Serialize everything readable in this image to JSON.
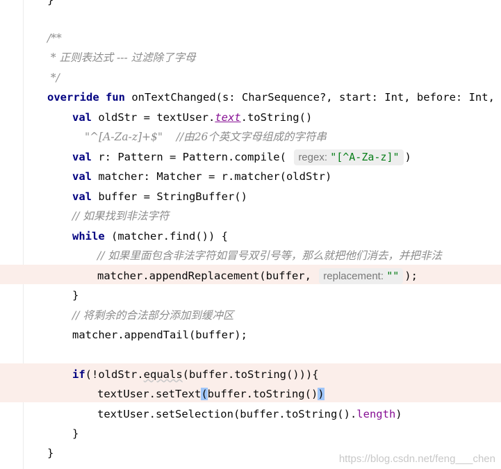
{
  "editor": {
    "top_brace": "}",
    "doc_start": "/**",
    "doc_title": " * 正则表达式 --- 过滤除了字母",
    "doc_end": " */",
    "sig": {
      "kw1": "override",
      "kw2": "fun",
      "rest": " onTextChanged(s: CharSequence?, start: Int, before: Int, cou"
    },
    "l_oldStr": {
      "kw": "val",
      "a": " oldStr = textUser.",
      "prop": "text",
      "b": ".toString()"
    },
    "l_regex_comment": {
      "str": "\"^[A-Za-z]+$\"",
      "comment": "    //由26个英文字母组成的字符串"
    },
    "l_pattern": {
      "kw": "val",
      "a": " r: Pattern = Pattern.compile(",
      "hint_label": "regex:",
      "hint_value": "\"[^A-Za-z]\"",
      "b": ")"
    },
    "l_matcher": {
      "kw": "val",
      "a": " matcher: Matcher = r.matcher(oldStr)"
    },
    "l_buffer": {
      "kw": "val",
      "a": " buffer = StringBuffer()"
    },
    "l_comment_find": "// 如果找到非法字符",
    "l_while": {
      "kw": "while",
      "a": " (matcher.find()) {"
    },
    "l_comment_inner": "// 如果里面包含非法字符如冒号双引号等，那么就把他们消去，并把非法",
    "l_append": {
      "a": "matcher.appendReplacement(buffer,",
      "hint_label": "replacement:",
      "hint_value": "\"\"",
      "b": ");"
    },
    "l_close_while": "}",
    "l_comment_tail": "// 将剩余的合法部分添加到缓冲区",
    "l_appendTail": "matcher.appendTail(buffer);",
    "l_if": {
      "kw": "if",
      "a": "(!oldStr.",
      "method": "equals",
      "b": "(buffer.toString())){"
    },
    "l_setText": {
      "a": "textUser.setText",
      "paren_open": "(",
      "b": "buffer.toString()",
      "paren_close": ")"
    },
    "l_setSelection": {
      "a": "textUser.setSelection(buffer.toString().",
      "prop": "length",
      "b": ")"
    },
    "l_close_if": "}",
    "l_close_fun": "}"
  },
  "watermark": "https://blog.csdn.net/feng___chen"
}
